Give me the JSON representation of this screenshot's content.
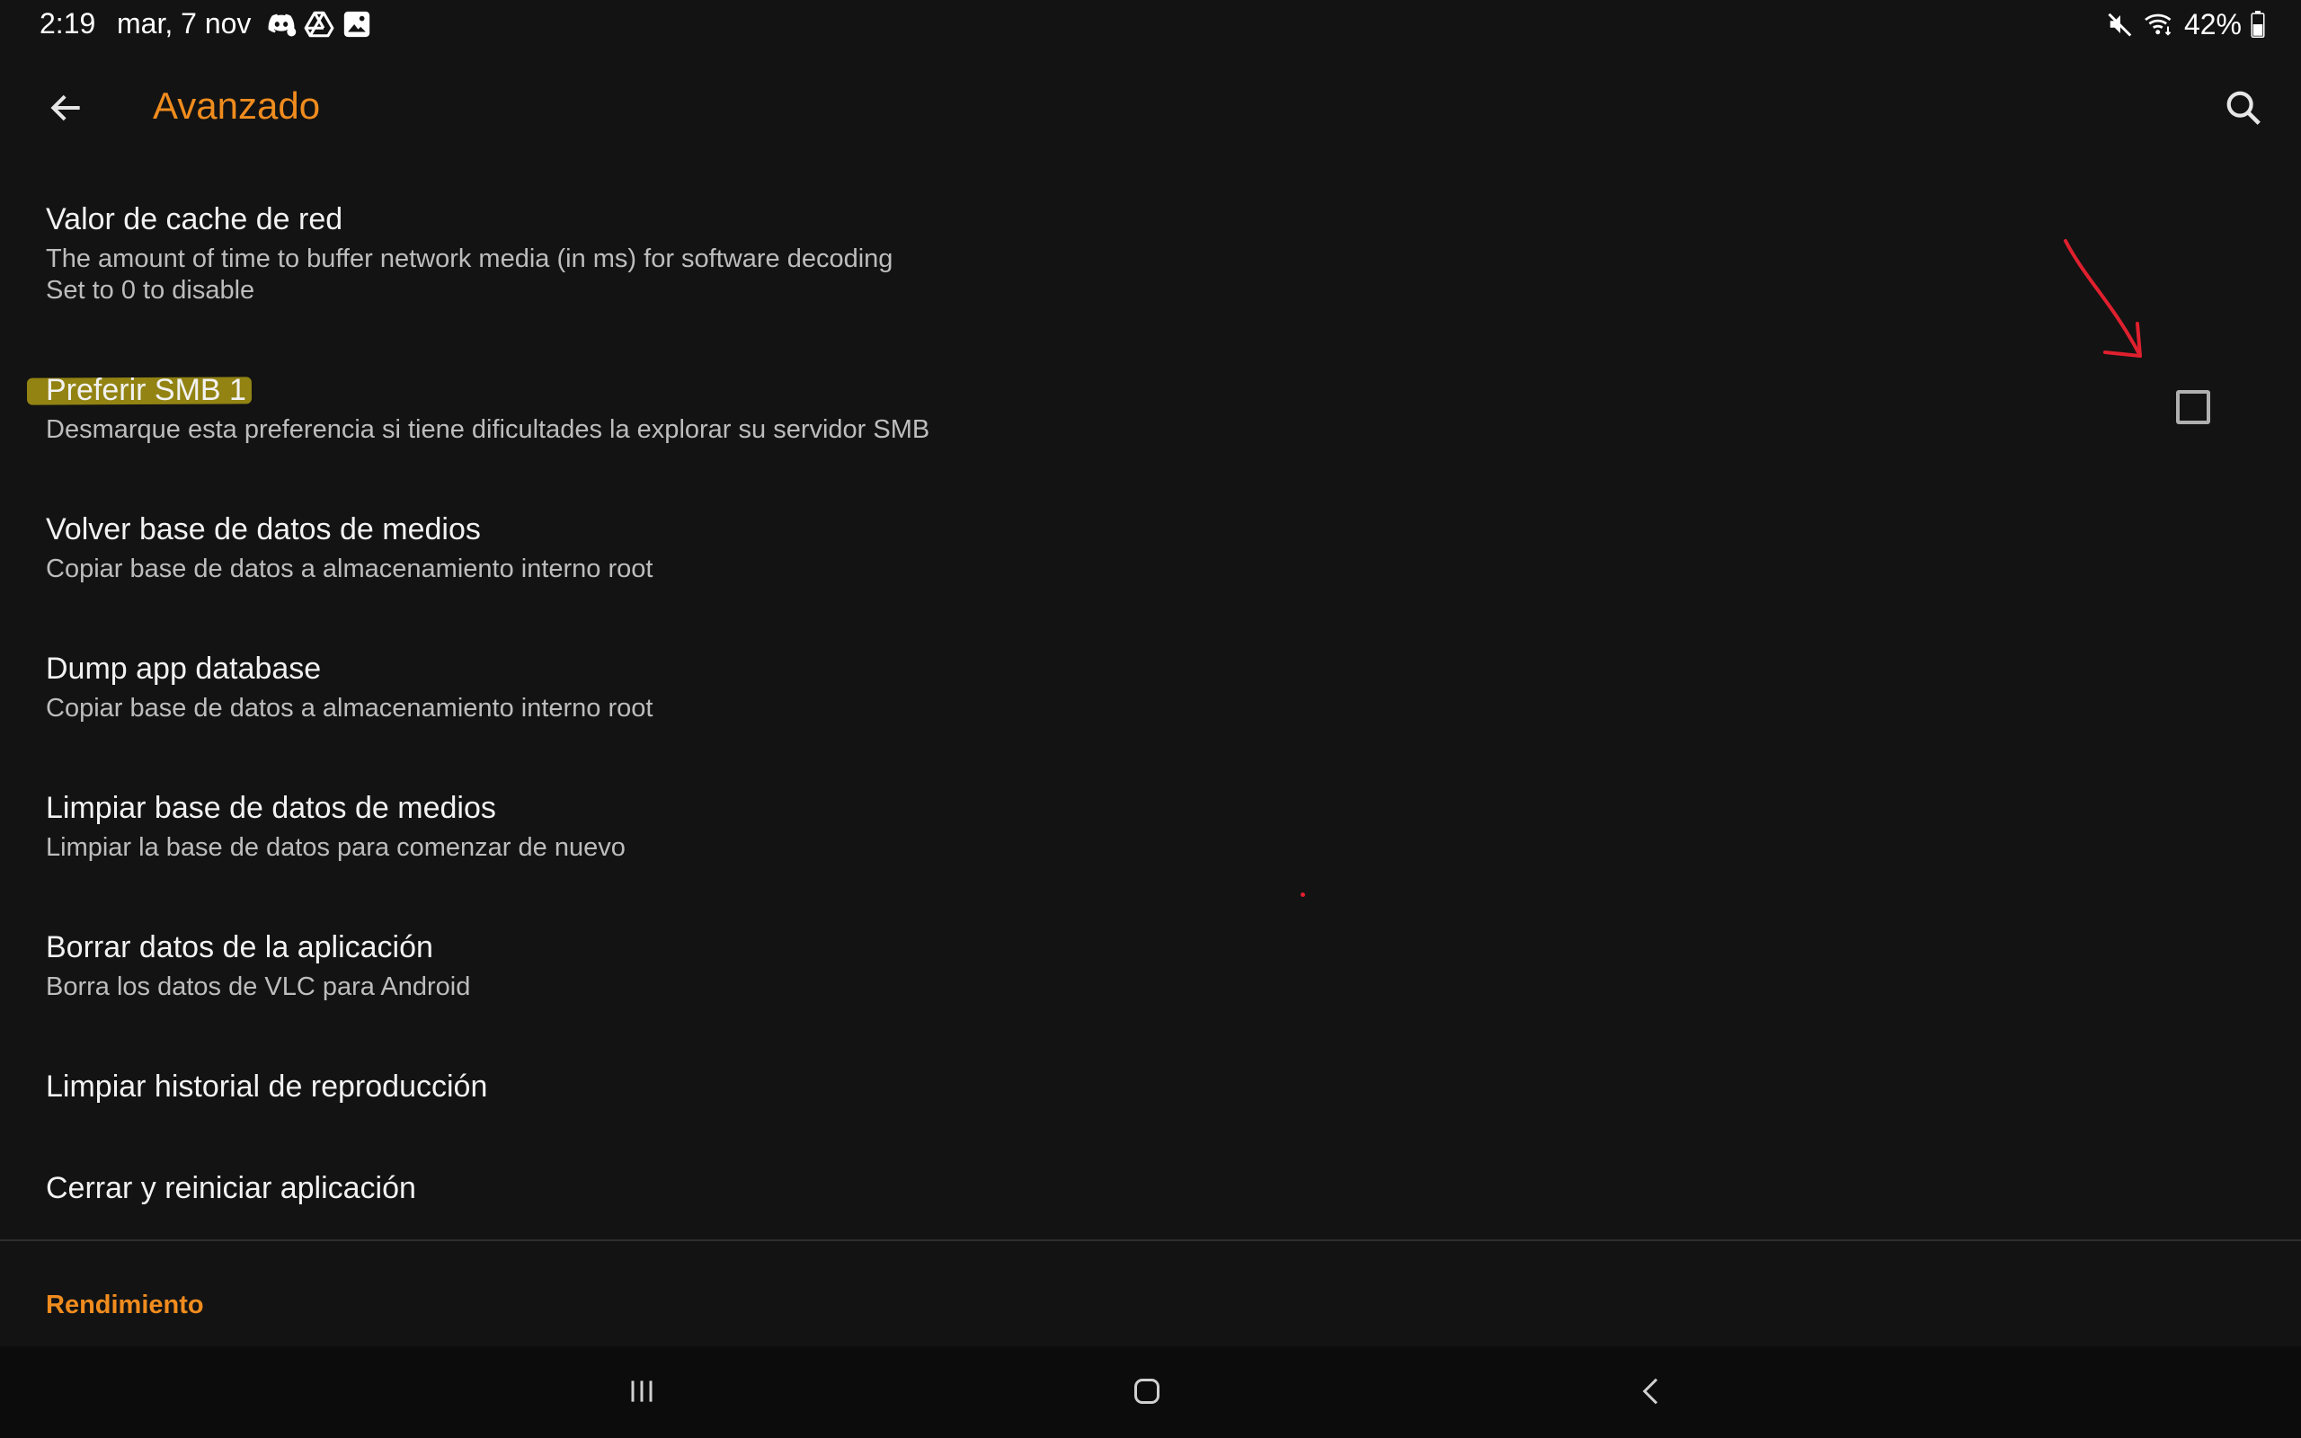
{
  "status_bar": {
    "time": "2:19",
    "date": "mar, 7 nov",
    "battery": "42%",
    "icons": [
      "discord-icon",
      "drive-icon",
      "gallery-icon",
      "mute-icon",
      "wifi-icon",
      "battery-icon"
    ]
  },
  "app_bar": {
    "title": "Avanzado",
    "accent_color": "#f08c1e"
  },
  "preferences": [
    {
      "title": "Valor de cache de red",
      "summary_lines": [
        "The amount of time to buffer network media (in ms) for software decoding",
        "Set to 0 to disable"
      ]
    },
    {
      "title": "Preferir SMB 1",
      "summary_lines": [
        "Desmarque esta preferencia si tiene dificultades la explorar su servidor SMB"
      ],
      "checked": false
    },
    {
      "title": "Volver base de datos de medios",
      "summary_lines": [
        "Copiar base de datos a almacenamiento interno root"
      ]
    },
    {
      "title": "Dump app database",
      "summary_lines": [
        "Copiar base de datos a almacenamiento interno root"
      ]
    },
    {
      "title": "Limpiar base de datos de medios",
      "summary_lines": [
        "Limpiar la base de datos para comenzar de nuevo"
      ]
    },
    {
      "title": "Borrar datos de la aplicación",
      "summary_lines": [
        "Borra los datos de VLC para Android"
      ]
    },
    {
      "title": "Limpiar historial de reproducción",
      "summary_lines": []
    },
    {
      "title": "Cerrar y reiniciar aplicación",
      "summary_lines": []
    }
  ],
  "category": {
    "title": "Rendimiento"
  },
  "annotations": {
    "highlight_color": "#beaa14",
    "arrow_color": "#e0202e"
  },
  "nav_bar": {
    "buttons": [
      "recents-icon",
      "home-icon",
      "back-icon"
    ]
  }
}
